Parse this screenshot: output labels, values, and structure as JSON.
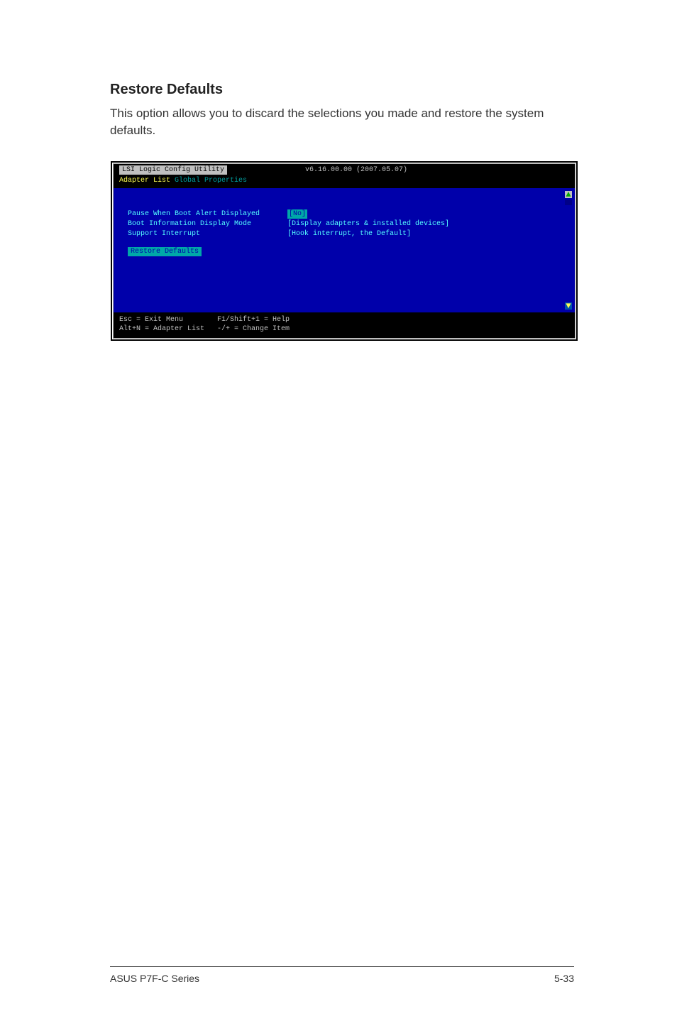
{
  "section": {
    "title": "Restore Defaults",
    "body": "This option allows you to discard the selections you made and restore the system defaults."
  },
  "bios": {
    "header": {
      "title": "LSI Logic Config Utility",
      "version": "v6.16.00.00 (2007.05.07)"
    },
    "subheader": {
      "adapter": "Adapter List",
      "global": "Global Properties"
    },
    "rows": [
      {
        "label": "Pause When Boot Alert Displayed",
        "value": "[No]",
        "selected": true
      },
      {
        "label": "Boot Information Display Mode",
        "value": "[Display adapters & installed devices]",
        "selected": false
      },
      {
        "label": "Support Interrupt",
        "value": "[Hook interrupt, the Default]",
        "selected": false
      }
    ],
    "restore": "Restore Defaults",
    "scroll_up": "▲",
    "scroll_down": "▼",
    "footer_line1": "Esc = Exit Menu        F1/Shift+1 = Help",
    "footer_line2": "Alt+N = Adapter List   -/+ = Change Item"
  },
  "footer": {
    "left": "ASUS P7F-C Series",
    "right": "5-33"
  }
}
